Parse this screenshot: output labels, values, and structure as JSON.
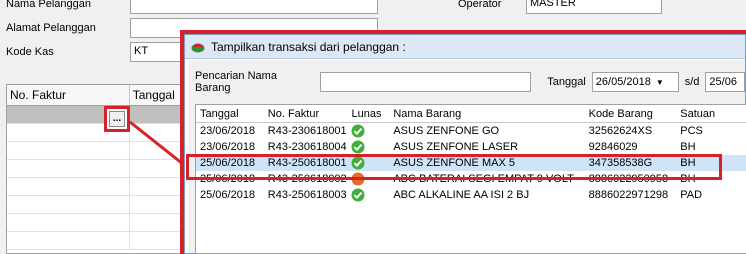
{
  "background_form": {
    "nama_pelanggan_label": "Nama Pelanggan",
    "alamat_pelanggan_label": "Alamat Pelanggan",
    "kode_kas_label": "Kode Kas",
    "kode_kas_value": "KT",
    "operator_label": "Operator",
    "operator_value": "MASTER",
    "grid_headers": [
      "No. Faktur",
      "Tanggal"
    ],
    "ellipsis_button": "..."
  },
  "dialog": {
    "title": "Tampilkan transaksi dari pelanggan :",
    "search_label": "Pencarian Nama Barang",
    "search_value": "",
    "date_label": "Tanggal",
    "date_from": "26/05/2018",
    "date_sep": "s/d",
    "date_to": "25/06",
    "columns": [
      "Tanggal",
      "No. Faktur",
      "Lunas",
      "Nama Barang",
      "Kode Barang",
      "Satuan"
    ],
    "rows": [
      {
        "tanggal": "23/06/2018",
        "faktur": "R43-230618001",
        "lunas": "yes",
        "nama": "ASUS ZENFONE GO",
        "kode": "32562624XS",
        "satuan": "PCS"
      },
      {
        "tanggal": "23/06/2018",
        "faktur": "R43-230618004",
        "lunas": "yes",
        "nama": "ASUS ZENFONE LASER",
        "kode": "92846029",
        "satuan": "BH"
      },
      {
        "tanggal": "25/06/2018",
        "faktur": "R43-250618001",
        "lunas": "yes",
        "nama": "ASUS ZENFONE MAX 5",
        "kode": "347358538G",
        "satuan": "BH"
      },
      {
        "tanggal": "25/06/2018",
        "faktur": "R43-250618002",
        "lunas": "no",
        "nama": "ABC BATERAI SEGI EMPAT 9 VOLT",
        "kode": "8886022950958",
        "satuan": "BH"
      },
      {
        "tanggal": "25/06/2018",
        "faktur": "R43-250618003",
        "lunas": "yes",
        "nama": "ABC ALKALINE AA ISI 2 BJ",
        "kode": "8886022971298",
        "satuan": "PAD"
      }
    ],
    "selected_row": 2
  },
  "colors": {
    "highlight_red": "#d6202a",
    "selected_row": "#cfe4f7",
    "check_green": "#3fae3b",
    "check_orange": "#e86b2b"
  }
}
